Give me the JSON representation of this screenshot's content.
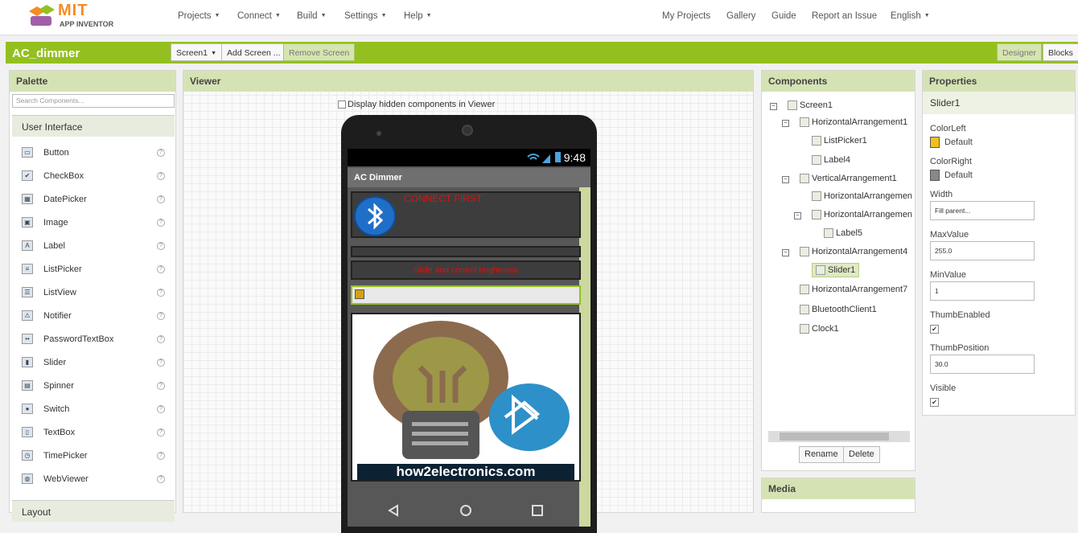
{
  "topbar": {
    "logo_text": "MIT",
    "logo_subtitle": "APP INVENTOR",
    "nav_left": [
      "Projects",
      "Connect",
      "Build",
      "Settings",
      "Help"
    ],
    "nav_right": [
      "My Projects",
      "Gallery",
      "Guide",
      "Report an Issue",
      "English"
    ]
  },
  "titlebar": {
    "project": "AC_dimmer",
    "screen_select": "Screen1",
    "add_screen": "Add Screen ...",
    "remove_screen": "Remove Screen",
    "designer": "Designer",
    "blocks": "Blocks"
  },
  "palette": {
    "title": "Palette",
    "search_placeholder": "Search Components...",
    "section": "User Interface",
    "next_section": "Layout",
    "items": [
      "Button",
      "CheckBox",
      "DatePicker",
      "Image",
      "Label",
      "ListPicker",
      "ListView",
      "Notifier",
      "PasswordTextBox",
      "Slider",
      "Spinner",
      "Switch",
      "TextBox",
      "TimePicker",
      "WebViewer"
    ]
  },
  "viewer": {
    "title": "Viewer",
    "hidden_label": "Display hidden components in Viewer",
    "phone": {
      "time": "9:48",
      "app_title": "AC Dimmer",
      "connect_text": "CONNECT FIRST",
      "slide_text": "Slide and control brightness",
      "banner": "how2electronics.com"
    }
  },
  "components": {
    "title": "Components",
    "tree": [
      "Screen1",
      "HorizontalArrangement1",
      "ListPicker1",
      "Label4",
      "VerticalArrangement1",
      "HorizontalArrangemen",
      "HorizontalArrangemen",
      "Label5",
      "HorizontalArrangement4",
      "Slider1",
      "HorizontalArrangement7",
      "BluetoothClient1",
      "Clock1"
    ],
    "rename": "Rename",
    "delete": "Delete"
  },
  "media": {
    "title": "Media"
  },
  "properties": {
    "title": "Properties",
    "selected": "Slider1",
    "color_left_label": "ColorLeft",
    "color_left_value": "Default",
    "color_left": "#f0c020",
    "color_right_label": "ColorRight",
    "color_right_value": "Default",
    "color_right": "#888888",
    "width_label": "Width",
    "width_value": "Fill parent...",
    "max_label": "MaxValue",
    "max_value": "255.0",
    "min_label": "MinValue",
    "min_value": "1",
    "thumb_enabled_label": "ThumbEnabled",
    "thumb_pos_label": "ThumbPosition",
    "thumb_pos_value": "30.0",
    "visible_label": "Visible"
  }
}
